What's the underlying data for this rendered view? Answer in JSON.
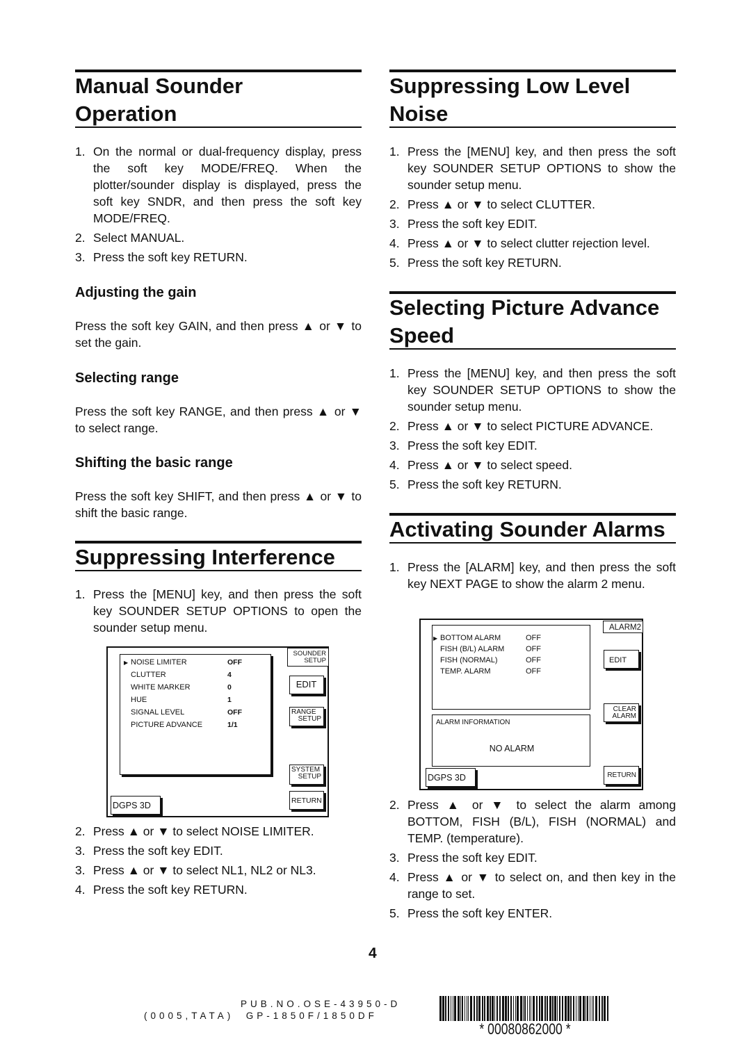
{
  "left": {
    "manual": {
      "title_l1": "Manual Sounder",
      "title_l2": "Operation",
      "steps": [
        {
          "n": "1.",
          "t": "On the normal or dual-frequency display, press the soft key MODE/FREQ. When the plotter/sounder display is displayed, press the soft key SNDR, and then press the soft key MODE/FREQ."
        },
        {
          "n": "2.",
          "t": "Select MANUAL."
        },
        {
          "n": "3.",
          "t": "Press the soft key RETURN."
        }
      ]
    },
    "gain": {
      "title": "Adjusting the gain",
      "text": "Press the soft key GAIN, and then press ▲ or ▼ to set the gain."
    },
    "range": {
      "title": "Selecting range",
      "text": "Press the soft key RANGE, and then press ▲ or ▼ to select range."
    },
    "shift": {
      "title": "Shifting the basic range",
      "text": "Press the soft key SHIFT, and then press ▲ or ▼ to shift the basic range."
    },
    "interference": {
      "title": "Suppressing Interference",
      "steps_a": [
        {
          "n": "1.",
          "t": "Press the [MENU] key, and then press the soft key SOUNDER SETUP OPTIONS to open the sounder setup menu."
        }
      ],
      "steps_b": [
        {
          "n": "2.",
          "t": "Press ▲ or ▼ to select NOISE LIMITER."
        },
        {
          "n": "3.",
          "t": "Press the soft key EDIT."
        },
        {
          "n": "3.",
          "t": "Press ▲ or ▼ to select NL1, NL2 or NL3."
        },
        {
          "n": "4.",
          "t": "Press the soft key RETURN."
        }
      ]
    },
    "figure": {
      "menu": [
        {
          "label": "NOISE LIMITER",
          "value": "OFF",
          "bold": true
        },
        {
          "label": "CLUTTER",
          "value": "4",
          "bold": true
        },
        {
          "label": "WHITE MARKER",
          "value": "0",
          "bold": true
        },
        {
          "label": "HUE",
          "value": "1",
          "bold": true
        },
        {
          "label": "SIGNAL LEVEL",
          "value": "OFF",
          "bold": true
        },
        {
          "label": "PICTURE ADVANCE",
          "value": "1/1",
          "bold": true
        }
      ],
      "title_l1": "SOUNDER",
      "title_l2": "SETUP",
      "edit": "EDIT",
      "range_l1": "RANGE",
      "range_l2": "SETUP",
      "system_l1": "SYSTEM",
      "system_l2": "SETUP",
      "return": "RETURN",
      "status": "DGPS 3D"
    }
  },
  "right": {
    "lownoise": {
      "title_l1": "Suppressing Low Level",
      "title_l2": "Noise",
      "steps": [
        {
          "n": "1.",
          "t": "Press the [MENU] key, and then press the soft key SOUNDER SETUP OPTIONS to show the sounder setup menu."
        },
        {
          "n": "2.",
          "t": "Press ▲ or ▼ to select CLUTTER."
        },
        {
          "n": "3.",
          "t": "Press the soft key EDIT."
        },
        {
          "n": "4.",
          "t": "Press ▲ or ▼ to select clutter rejection level."
        },
        {
          "n": "5.",
          "t": "Press the soft key RETURN."
        }
      ]
    },
    "advance": {
      "title_l1": "Selecting Picture Advance",
      "title_l2": "Speed",
      "steps": [
        {
          "n": "1.",
          "t": "Press the [MENU] key, and then press the soft key SOUNDER SETUP OPTIONS to show the sounder setup menu."
        },
        {
          "n": "2.",
          "t": "Press ▲ or ▼ to select PICTURE ADVANCE."
        },
        {
          "n": "3.",
          "t": "Press the soft key EDIT."
        },
        {
          "n": "4.",
          "t": "Press ▲ or ▼ to select speed."
        },
        {
          "n": "5.",
          "t": "Press the soft key RETURN."
        }
      ]
    },
    "alarms": {
      "title": "Activating Sounder Alarms",
      "steps_a": [
        {
          "n": "1.",
          "t": "Press the [ALARM] key, and then press the soft key NEXT PAGE to show the alarm 2 menu."
        }
      ],
      "steps_b": [
        {
          "n": "2.",
          "t": "Press ▲ or ▼ to select the alarm among BOTTOM, FISH (B/L), FISH (NORMAL) and TEMP. (temperature)."
        },
        {
          "n": "3.",
          "t": "Press the soft key EDIT."
        },
        {
          "n": "4.",
          "t": "Press ▲ or ▼ to select on, and then key in the range to set."
        },
        {
          "n": "5.",
          "t": "Press the soft key ENTER."
        }
      ]
    },
    "figure": {
      "menu": [
        {
          "label": "BOTTOM ALARM",
          "value": "OFF"
        },
        {
          "label": "FISH (B/L) ALARM",
          "value": "OFF"
        },
        {
          "label": "FISH (NORMAL)",
          "value": "OFF"
        },
        {
          "label": "TEMP. ALARM",
          "value": "OFF"
        }
      ],
      "title": "ALARM2",
      "edit": "EDIT",
      "clear_l1": "CLEAR",
      "clear_l2": "ALARM",
      "info_label": "ALARM INFORMATION",
      "info_value": "NO ALARM",
      "return": "RETURN",
      "status": "DGPS 3D"
    }
  },
  "footer": {
    "page": "4",
    "pub": "PUB.NO.OSE-43950-D",
    "model": "(0005,TATA)  GP-1850F/1850DF",
    "barcode_text": "* 00080862000 *"
  }
}
